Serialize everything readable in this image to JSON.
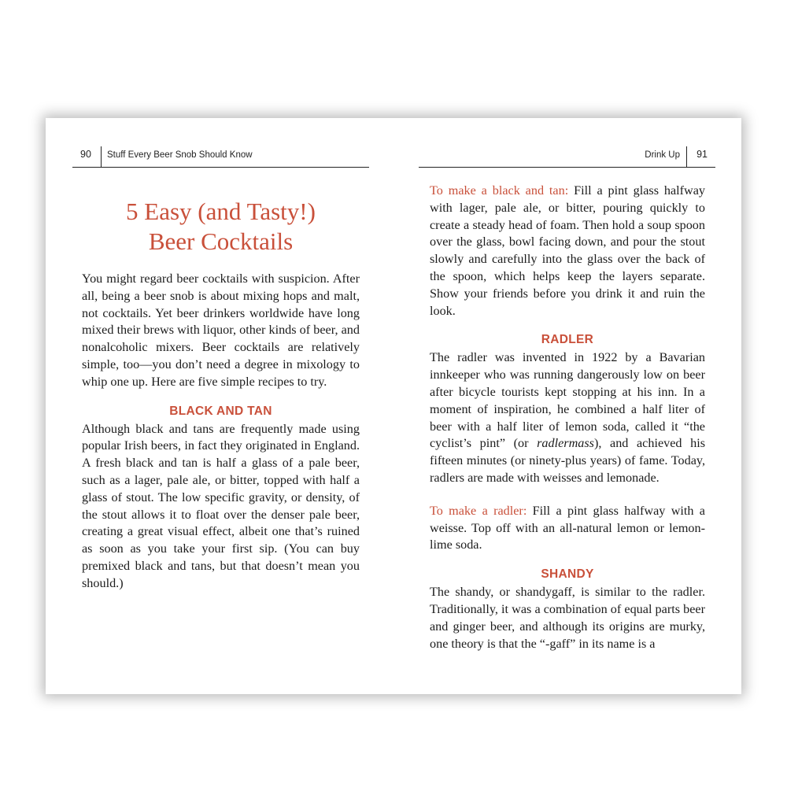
{
  "left_page": {
    "header": {
      "number": "90",
      "title": "Stuff Every Beer Snob Should Know"
    },
    "title_line1": "5 Easy (and Tasty!)",
    "title_line2": "Beer Cocktails",
    "intro": "You might regard beer cocktails with suspicion. After all, being a beer snob is about mixing hops and malt, not cocktails. Yet beer drinkers worldwide have long mixed their brews with liquor, other kinds of beer, and nonalcoholic mixers. Beer cocktails are relatively simple, too—you don’t need a degree in mixology to whip one up. Here are five simple recipes to try.",
    "section1_heading": "BLACK AND TAN",
    "section1_body": "Although black and tans are frequently made using popular Irish beers, in fact they originated in England. A fresh black and tan is half a glass of a pale beer, such as a lager, pale ale, or bitter, topped with half a glass of stout. The low specific gravity, or density, of the stout allows it to float over the denser pale beer, creating a great visual effect, albeit one that’s ruined as soon as you take your first sip. (You can buy premixed black and tans, but that doesn’t mean you should.)"
  },
  "right_page": {
    "header": {
      "number": "91",
      "title": "Drink Up"
    },
    "black_tan_recipe": {
      "lead": "To make a black and tan:",
      "text": " Fill a pint glass halfway with lager, pale ale, or bitter, pouring quickly to create a steady head of foam. Then hold a soup spoon over the glass, bowl facing down, and pour the stout slowly and carefully into the glass over the back of the spoon, which helps keep the layers separate. Show your friends before you drink it and ruin the look."
    },
    "radler_heading": "RADLER",
    "radler_body": {
      "before": "The radler was invented in 1922 by a Bavarian innkeeper who was running dangerously low on beer after bicycle tourists kept stopping at his inn. In a moment of inspiration, he combined a half liter of beer with a half liter of lemon soda, called it “the cyclist’s pint” (or ",
      "italic": "radlermass",
      "after": "), and achieved his fifteen minutes (or ninety-plus years) of fame. Today, radlers are made with weisses and lemonade."
    },
    "radler_recipe": {
      "lead": "To make a radler:",
      "text": " Fill a pint glass halfway with a weisse. Top off with an all-natural lemon or lemon-lime soda."
    },
    "shandy_heading": "SHANDY",
    "shandy_body": "The shandy, or shandygaff, is similar to the radler. Traditionally, it was a combination of equal parts beer and ginger beer, and although its origins are murky, one theory is that the “-gaff” in its name is a"
  }
}
